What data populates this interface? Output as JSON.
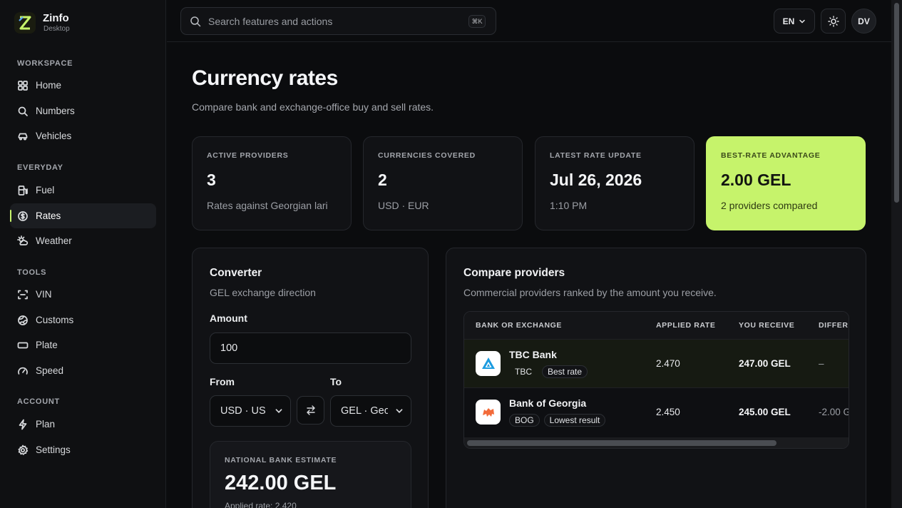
{
  "app": {
    "name": "Zinfo",
    "subtitle": "Desktop"
  },
  "sidebar": {
    "sections": [
      {
        "label": "WORKSPACE"
      },
      {
        "label": "EVERYDAY"
      },
      {
        "label": "TOOLS"
      },
      {
        "label": "ACCOUNT"
      }
    ],
    "items": [
      {
        "label": "Home",
        "icon": "grid-icon"
      },
      {
        "label": "Numbers",
        "icon": "search-icon"
      },
      {
        "label": "Vehicles",
        "icon": "car-icon"
      },
      {
        "label": "Fuel",
        "icon": "fuel-icon"
      },
      {
        "label": "Rates",
        "icon": "coin-icon",
        "active": true
      },
      {
        "label": "Weather",
        "icon": "weather-icon"
      },
      {
        "label": "VIN",
        "icon": "scan-icon"
      },
      {
        "label": "Customs",
        "icon": "globe-icon"
      },
      {
        "label": "Plate",
        "icon": "plate-icon"
      },
      {
        "label": "Speed",
        "icon": "gauge-icon"
      },
      {
        "label": "Plan",
        "icon": "bolt-icon"
      },
      {
        "label": "Settings",
        "icon": "gear-icon"
      }
    ]
  },
  "topbar": {
    "search_placeholder": "Search features and actions",
    "shortcut": "⌘K",
    "language": "EN",
    "avatar": "DV"
  },
  "page": {
    "title": "Currency rates",
    "subtitle": "Compare bank and exchange-office buy and sell rates."
  },
  "stats": [
    {
      "label": "ACTIVE PROVIDERS",
      "value": "3",
      "sub": "Rates against Georgian lari"
    },
    {
      "label": "CURRENCIES COVERED",
      "value": "2",
      "sub": "USD · EUR"
    },
    {
      "label": "LATEST RATE UPDATE",
      "value": "Jul 26, 2026",
      "sub": "1:10 PM"
    },
    {
      "label": "BEST-RATE ADVANTAGE",
      "value": "2.00 GEL",
      "sub": "2 providers compared"
    }
  ],
  "converter": {
    "title": "Converter",
    "subtitle": "GEL exchange direction",
    "amount_label": "Amount",
    "amount_value": "100",
    "from_label": "From",
    "to_label": "To",
    "from_value": "USD · US",
    "to_value": "GEL · Geo",
    "estimate_label": "NATIONAL BANK ESTIMATE",
    "estimate_value": "242.00 GEL",
    "estimate_sub": "Applied rate: 2.420"
  },
  "compare": {
    "title": "Compare providers",
    "subtitle": "Commercial providers ranked by the amount you receive.",
    "columns": [
      "BANK OR EXCHANGE",
      "APPLIED RATE",
      "YOU RECEIVE",
      "DIFFER"
    ],
    "rows": [
      {
        "name": "TBC Bank",
        "code": "TBC",
        "badge": "Best rate",
        "rate": "2.470",
        "receive": "247.00 GEL",
        "diff": "–"
      },
      {
        "name": "Bank of Georgia",
        "code": "BOG",
        "badge": "Lowest result",
        "rate": "2.450",
        "receive": "245.00 GEL",
        "diff": "-2.00 G"
      }
    ]
  },
  "colors": {
    "accent": "#c6f36b",
    "background": "#0b0c0e",
    "card": "#111215"
  }
}
